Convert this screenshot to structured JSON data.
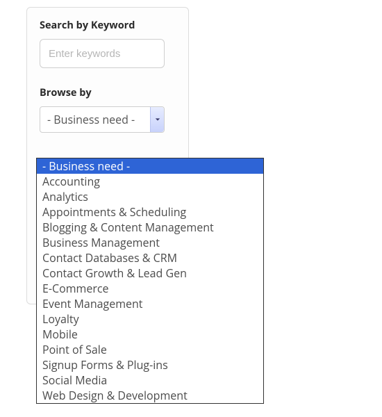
{
  "search": {
    "label": "Search by Keyword",
    "placeholder": "Enter keywords",
    "value": ""
  },
  "browse": {
    "label": "Browse by",
    "selected": "- Business need -",
    "options": [
      "- Business need -",
      "Accounting",
      "Analytics",
      "Appointments & Scheduling",
      "Blogging & Content Management",
      "Business Management",
      "Contact Databases & CRM",
      "Contact Growth & Lead Gen",
      "E-Commerce",
      "Event Management",
      "Loyalty",
      "Mobile",
      "Point of Sale",
      "Signup Forms & Plug-ins",
      "Social Media",
      "Web Design & Development"
    ],
    "highlighted_index": 0
  }
}
